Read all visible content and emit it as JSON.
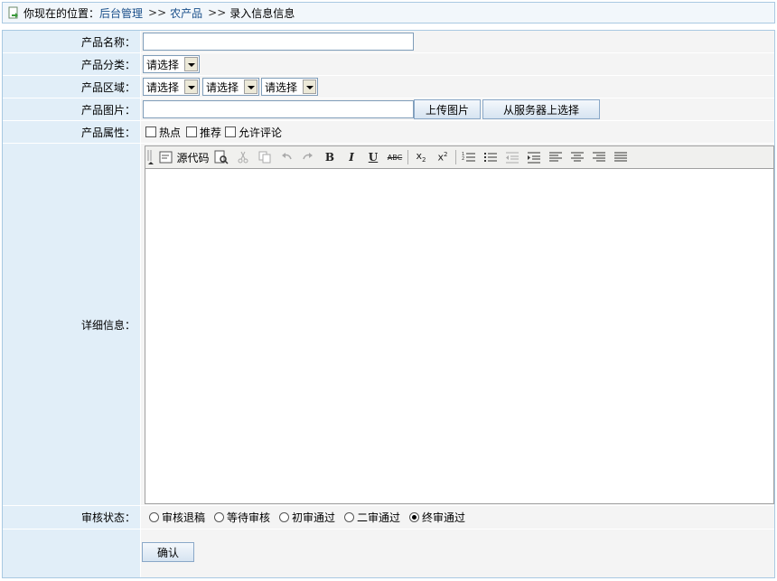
{
  "breadcrumb": {
    "prefix": "你现在的位置：",
    "links": [
      "后台管理",
      "农产品"
    ],
    "separator": ">>",
    "current": "录入信息信息"
  },
  "form": {
    "name": {
      "label": "产品名称：",
      "value": ""
    },
    "category": {
      "label": "产品分类：",
      "selected": "请选择"
    },
    "region": {
      "label": "产品区域：",
      "selects": [
        "请选择",
        "请选择",
        "请选择"
      ]
    },
    "image": {
      "label": "产品图片：",
      "value": "",
      "upload_button": "上传图片",
      "server_button": "从服务器上选择"
    },
    "attributes": {
      "label": "产品属性：",
      "options": [
        {
          "label": "热点",
          "checked": false
        },
        {
          "label": "推荐",
          "checked": false
        },
        {
          "label": "允许评论",
          "checked": false
        }
      ]
    },
    "detail": {
      "label": "详细信息：",
      "source_label": "源代码"
    },
    "audit": {
      "label": "审核状态：",
      "options": [
        {
          "label": "审核退稿",
          "checked": false
        },
        {
          "label": "等待审核",
          "checked": false
        },
        {
          "label": "初审通过",
          "checked": false
        },
        {
          "label": "二审通过",
          "checked": false
        },
        {
          "label": "终审通过",
          "checked": true
        }
      ]
    },
    "submit_label": "确认"
  },
  "toolbar_icons": [
    "source-icon",
    "preview-icon",
    "cut-icon",
    "copy-icon",
    "undo-icon",
    "redo-icon",
    "bold-icon",
    "italic-icon",
    "underline-icon",
    "strikethrough-icon",
    "subscript-icon",
    "superscript-icon",
    "ordered-list-icon",
    "unordered-list-icon",
    "outdent-icon",
    "indent-icon",
    "align-left-icon",
    "align-center-icon",
    "align-right-icon",
    "justify-icon"
  ],
  "colors": {
    "label_bg": "#e1eef8",
    "border": "#a9c9e2",
    "link": "#1a4f8a"
  }
}
